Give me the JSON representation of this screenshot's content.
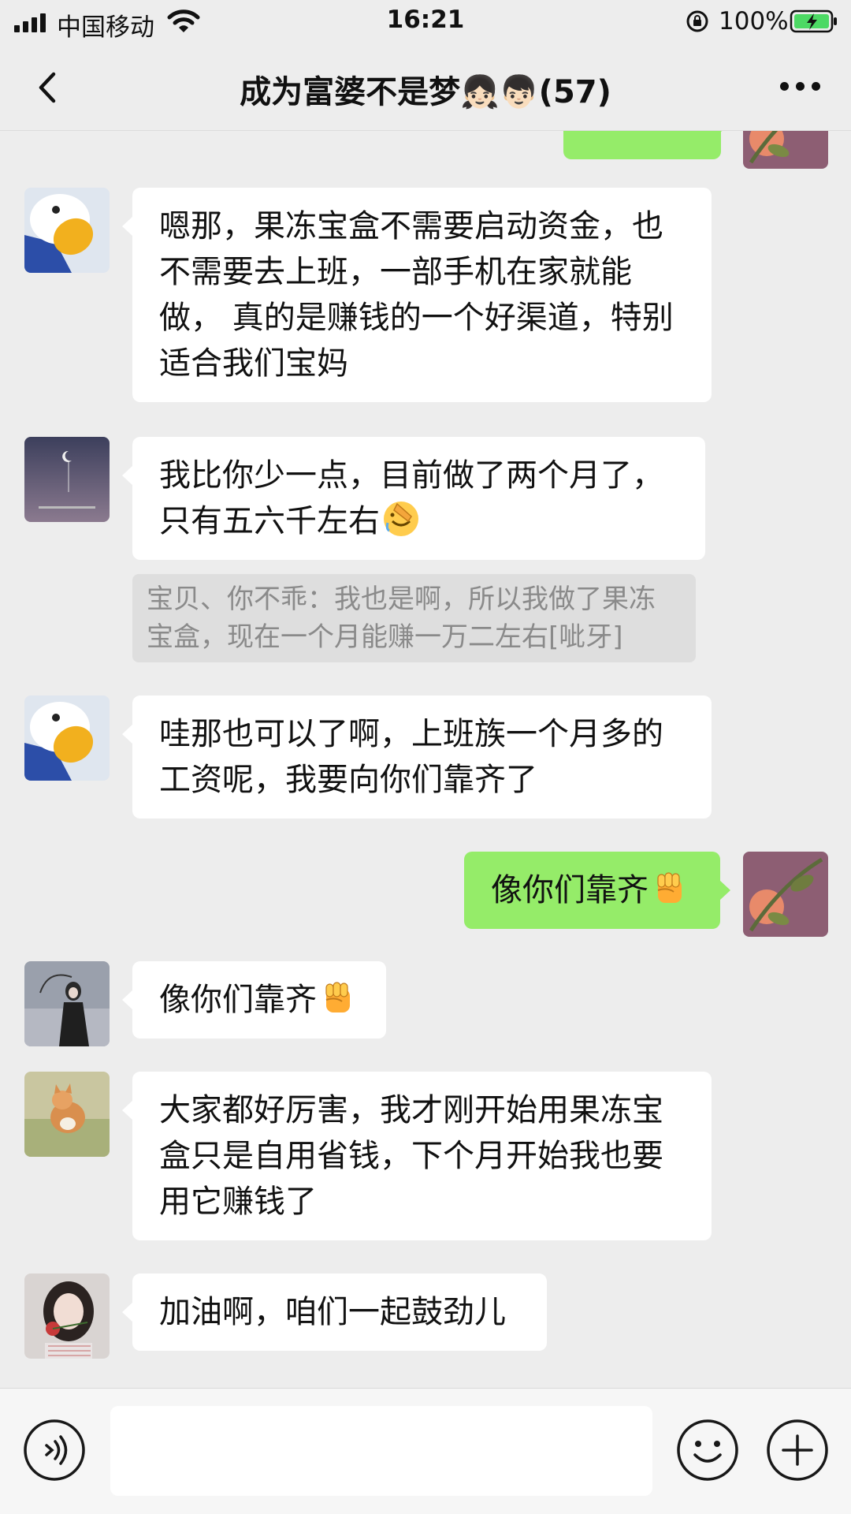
{
  "status_bar": {
    "carrier": "中国移动",
    "time": "16:21",
    "battery": "100%",
    "icons": [
      "signal-icon",
      "wifi-icon",
      "rotation-lock-icon",
      "battery-charging-icon"
    ]
  },
  "header": {
    "title": "成为富婆不是梦👧🏻👦🏻(57)",
    "back_icon": "chevron-left-icon",
    "more_icon": "more-icon"
  },
  "messages": [
    {
      "side": "left",
      "text": "嗯那，果冻宝盒不需要启动资金，也不需要去上班，一部手机在家就能做， 真的是赚钱的一个好渠道，特别适合我们宝妈"
    },
    {
      "side": "left",
      "text": "我比你少一点，目前做了两个月了，只有五六千左右",
      "emoji": "facepalm-emoji",
      "quote": "宝贝、你不乖：我也是啊，所以我做了果冻宝盒，现在一个月能赚一万二左右[呲牙]"
    },
    {
      "side": "left",
      "text": "哇那也可以了啊，上班族一个月多的工资呢，我要向你们靠齐了"
    },
    {
      "side": "right",
      "text": "像你们靠齐",
      "emoji": "raised-fist-emoji"
    },
    {
      "side": "left",
      "text": "像你们靠齐",
      "emoji": "raised-fist-emoji"
    },
    {
      "side": "left",
      "text": "大家都好厉害，我才刚开始用果冻宝盒只是自用省钱，下个月开始我也要用它赚钱了"
    },
    {
      "side": "left",
      "text": "加油啊，咱们一起鼓劲儿"
    }
  ],
  "input_bar": {
    "value": "",
    "voice_icon": "voice-icon",
    "emoji_icon": "emoji-smile-icon",
    "add_icon": "plus-icon"
  },
  "colors": {
    "background": "#ededed",
    "incoming_bubble": "#ffffff",
    "outgoing_bubble": "#95ec69",
    "quote_background": "#dedede",
    "quote_text": "#8a8a8a"
  }
}
